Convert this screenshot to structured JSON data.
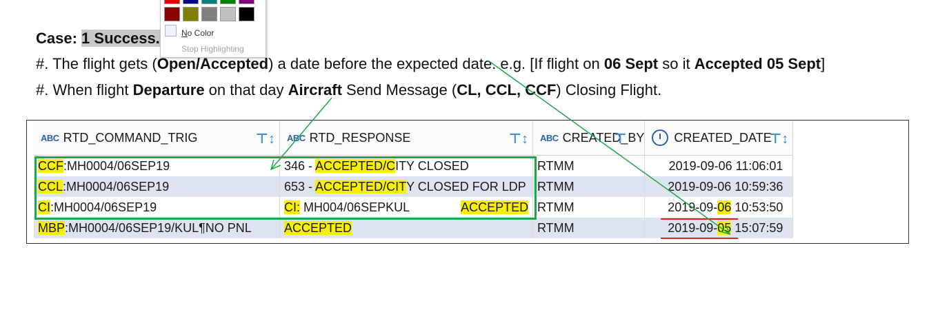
{
  "colors": {
    "accent_green": "#1aa84a",
    "highlight_yellow": "#f7ef00",
    "row_alt": "#dde4ef",
    "underline_red": "#e02020",
    "header_icon_blue": "#2c5fa8"
  },
  "popup": {
    "swatches_top": [
      "#e00000",
      "#00008b",
      "#008080",
      "#008000",
      "#800080"
    ],
    "swatches_bottom": [
      "#8b0000",
      "#808000",
      "#808080",
      "#c0c0c0",
      "#000000"
    ],
    "no_color_label": "No Color",
    "no_color_underline": "N",
    "no_color_rest": "o Color",
    "stop_label": "Stop Highlighting"
  },
  "doc": {
    "case_label": "Case:",
    "case_value": "1  Success.",
    "line1": {
      "prefix": "#. The flight gets (",
      "open_accepted": "Open/Accepted",
      "mid": ") a date before the expected date. e.g. [If flight on ",
      "date1": "06 Sept",
      "mid2": " so it ",
      "accepted_date": "Accepted 05 Sept",
      "suffix": "]"
    },
    "line2": {
      "prefix": "#. When flight ",
      "departure": "Departure",
      "mid": " on that day ",
      "aircraft": "Aircraft",
      "mid2": " Send Message (",
      "codes": "CL, CCL, CCF",
      "suffix": ") Closing Flight."
    }
  },
  "table": {
    "columns": [
      {
        "label": "RTD_COMMAND_TRIG",
        "icon": "abc-icon",
        "icon_text": "ABC"
      },
      {
        "label": "RTD_RESPONSE",
        "icon": "abc-icon",
        "icon_text": "ABC"
      },
      {
        "label": "CREATED_BY",
        "icon": "abc-icon",
        "icon_text": "ABC"
      },
      {
        "label": "CREATED_DATE",
        "icon": "clock-icon",
        "icon_text": ""
      }
    ],
    "rows": [
      {
        "cmd_code": "CCF",
        "cmd_rest": ":MH0004/06SEP19",
        "resp_pre": "346 - ",
        "resp_hl": "ACCEPTED/C",
        "resp_post": "ITY CLOSED",
        "created_by": "RTMM",
        "date_pre": "2019-09-06 11:06:01",
        "date_hl": "",
        "date_post": ""
      },
      {
        "cmd_code": "CCL",
        "cmd_rest": ":MH0004/06SEP19",
        "resp_pre": "653 - ",
        "resp_hl": "ACCEPTED/CIT",
        "resp_post": "Y CLOSED FOR LDP",
        "created_by": "RTMM",
        "date_pre": "2019-09-06 10:59:36",
        "date_hl": "",
        "date_post": ""
      },
      {
        "cmd_code": "CI",
        "cmd_rest": ":MH0004/06SEP19",
        "resp_pre": "",
        "resp_hl": "CI:",
        "resp_post": " MH004/06SEPKUL",
        "resp_tail": "ACCEPTED",
        "created_by": "RTMM",
        "date_pre": "2019-09-",
        "date_hl": "06",
        "date_post": " 10:53:50"
      },
      {
        "cmd_code": "MBP",
        "cmd_rest": ":MH0004/06SEP19/KUL¶NO PNL",
        "resp_pre": "",
        "resp_hl": "ACCEPTED",
        "resp_post": "",
        "created_by": "RTMM",
        "date_pre": "2019-09-",
        "date_hl": "05",
        "date_post": " 15:07:59"
      }
    ]
  }
}
